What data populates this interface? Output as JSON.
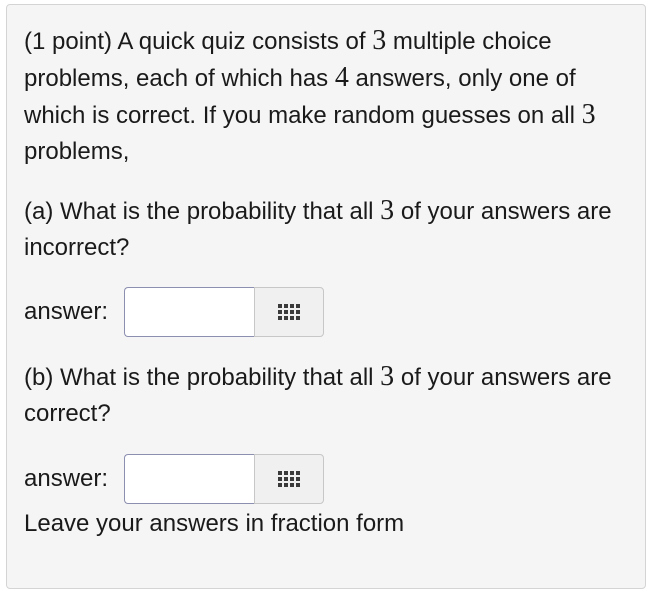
{
  "question": {
    "intro_before_problems": "(1 point) A quick quiz consists of",
    "num_problems": "3",
    "intro_after_problems": "multiple choice problems, each of which has",
    "num_answers": "4",
    "intro_after_answers": "answers, only one of which is correct. If you make random guesses on all",
    "intro_end": "problems,"
  },
  "part_a": {
    "text_before": "(a) What is the probability that all",
    "number": "3",
    "text_after": "of your answers are incorrect?",
    "answer_label": "answer:",
    "answer_value": ""
  },
  "part_b": {
    "text_before": "(b) What is the probability that all",
    "number": "3",
    "text_after": "of your answers are correct?",
    "answer_label": "answer:",
    "answer_value": ""
  },
  "footer_note": "Leave your answers in fraction form",
  "icons": {
    "keypad": "keypad-grid-icon"
  }
}
